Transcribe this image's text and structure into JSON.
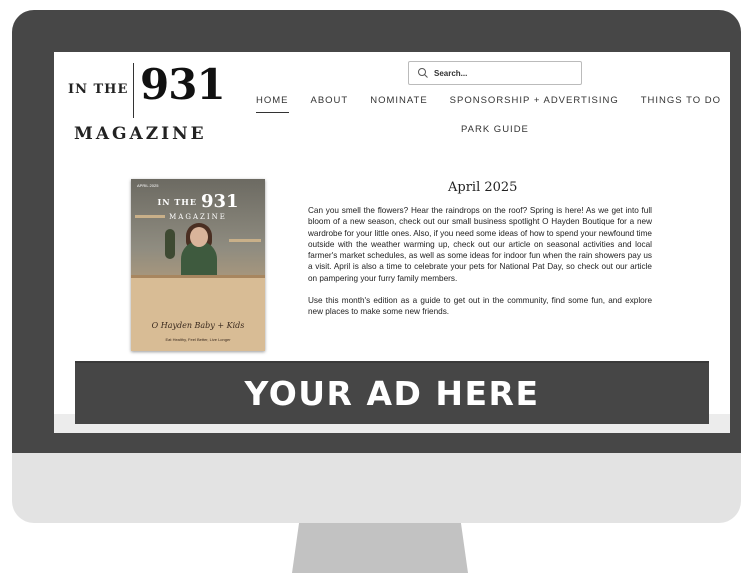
{
  "logo": {
    "prefix": "IN THE",
    "number": "931",
    "suffix": "MAGAZINE"
  },
  "search": {
    "placeholder": "Search..."
  },
  "nav": {
    "items": [
      {
        "label": "HOME",
        "active": true
      },
      {
        "label": "ABOUT"
      },
      {
        "label": "NOMINATE"
      },
      {
        "label": "SPONSORSHIP + ADVERTISING"
      },
      {
        "label": "THINGS TO DO"
      }
    ],
    "park_guide": "PARK GUIDE"
  },
  "cover": {
    "tag": "APRIL 2025",
    "title_prefix": "IN THE",
    "title_number": "931",
    "title_suffix": "MAGAZINE",
    "headline": "O Hayden Baby + Kids",
    "footer": "Eat Healthy, Feel Better, Live Longer"
  },
  "article": {
    "title": "April 2025",
    "paragraph1": "Can you smell the flowers? Hear the raindrops on the roof? Spring is here! As we get into full bloom of a new season, check out our small business spotlight O Hayden Boutique for a new wardrobe for your little ones. Also, if you need some ideas of how to spend your newfound time outside with the weather warming up, check out our article on seasonal activities and local farmer's market schedules, as well as some ideas for indoor fun when the rain showers pay us a visit. April is also a time to celebrate your pets for National Pat Day, so check out our article on pampering your furry family members.",
    "paragraph2": "Use this month's edition as a guide to get out in the community, find some fun, and explore new places to make some new friends."
  },
  "ad": {
    "text": "YOUR AD HERE"
  },
  "colors": {
    "monitor_bezel": "#474747",
    "monitor_chin": "#e3e3e3",
    "monitor_stand": "#c2c2c2",
    "ad_banner": "#464646"
  },
  "icons": [
    "search-icon"
  ]
}
